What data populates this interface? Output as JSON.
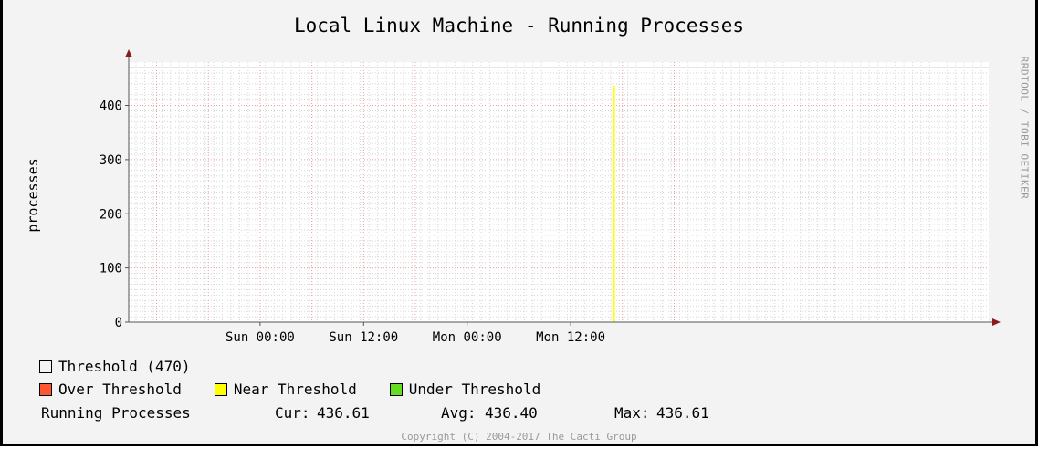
{
  "graph": {
    "title": "Local Linux Machine - Running Processes",
    "vendor_label": "RRDTOOL / TOBI OETIKER",
    "copyright": "Copyright (C) 2004-2017 The Cacti Group"
  },
  "legend": {
    "items": [
      {
        "label": "Threshold (470)",
        "color": "#f3f3f3"
      },
      {
        "label": "Over Threshold",
        "color": "#ff5533"
      },
      {
        "label": "Near Threshold",
        "color": "#ffff00"
      },
      {
        "label": "Under Threshold",
        "color": "#66dd22"
      }
    ],
    "series_label": "Running Processes",
    "cur_label": "Cur:",
    "cur_value": "436.61",
    "avg_label": "Avg:",
    "avg_value": "436.40",
    "max_label": "Max:",
    "max_value": "436.61"
  },
  "chart_data": {
    "type": "line",
    "title": "Local Linux Machine - Running Processes",
    "xlabel": "",
    "ylabel": "processes",
    "x_ticks": [
      "Sun 00:00",
      "Sun 12:00",
      "Mon 00:00",
      "Mon 12:00"
    ],
    "y_ticks": [
      0,
      100,
      200,
      300,
      400
    ],
    "ylim": [
      0,
      480
    ],
    "grid": true,
    "series": [
      {
        "name": "Running Processes",
        "color": "#ffff00",
        "points": [
          {
            "x": "Mon 17:00",
            "y": 436.61
          }
        ]
      }
    ],
    "threshold": 470
  }
}
